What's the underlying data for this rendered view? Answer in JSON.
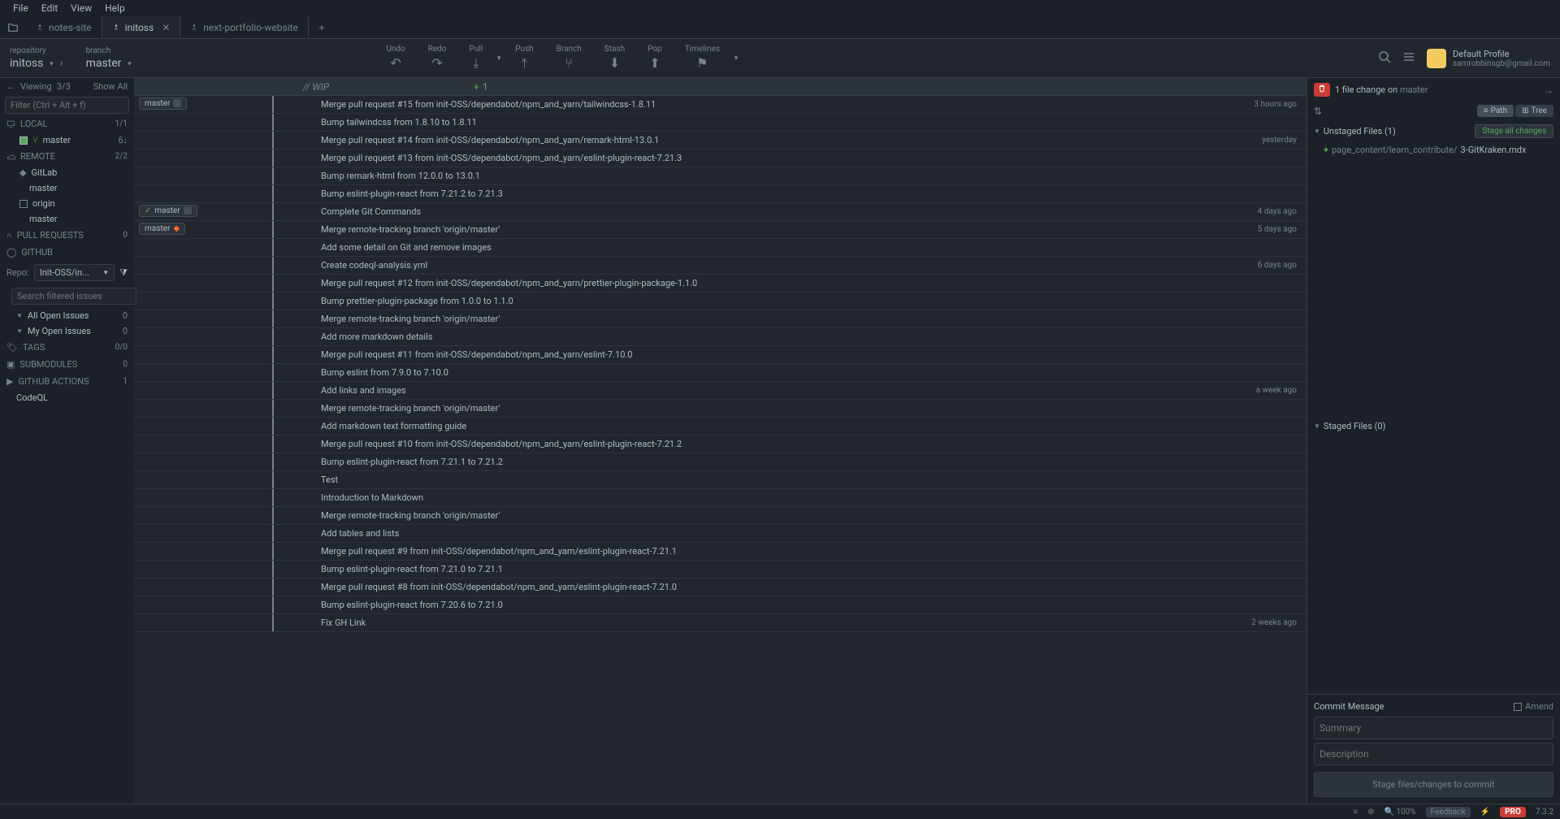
{
  "menubar": [
    "File",
    "Edit",
    "View",
    "Help"
  ],
  "tabs": [
    {
      "name": "notes-site",
      "active": false
    },
    {
      "name": "initoss",
      "active": true
    },
    {
      "name": "next-portfolio-website",
      "active": false
    }
  ],
  "toolbar": {
    "repository_label": "repository",
    "repository_value": "initoss",
    "branch_label": "branch",
    "branch_value": "master",
    "buttons": [
      "Undo",
      "Redo",
      "Pull",
      "Push",
      "Branch",
      "Stash",
      "Pop",
      "Timelines"
    ]
  },
  "profile": {
    "name": "Default Profile",
    "email": "samrobbinsgb@gmail.com"
  },
  "sidebar": {
    "viewing": "Viewing",
    "viewing_count": "3/3",
    "show_all": "Show All",
    "filter_placeholder": "Filter (Ctrl + Alt + f)",
    "local": {
      "label": "LOCAL",
      "count": "1/1",
      "items": [
        {
          "name": "master",
          "count": "6↓"
        }
      ]
    },
    "remote": {
      "label": "REMOTE",
      "count": "2/2",
      "items": [
        {
          "name": "GitLab",
          "children": [
            {
              "name": "master"
            }
          ]
        },
        {
          "name": "origin",
          "children": [
            {
              "name": "master"
            }
          ]
        }
      ]
    },
    "pull_requests": {
      "label": "PULL REQUESTS",
      "count": "0"
    },
    "github": {
      "label": "GITHUB"
    },
    "repo_label": "Repo:",
    "repo_value": "Init-OSS/in...",
    "search_placeholder": "Search filtered issues",
    "all_issues": {
      "label": "All Open Issues",
      "count": "0"
    },
    "my_issues": {
      "label": "My Open Issues",
      "count": "0"
    },
    "tags": {
      "label": "TAGS",
      "count": "0/0"
    },
    "submodules": {
      "label": "SUBMODULES",
      "count": "0"
    },
    "actions": {
      "label": "GITHUB ACTIONS",
      "count": "1",
      "items": [
        "CodeQL"
      ]
    }
  },
  "wip": {
    "label": "// WIP",
    "count": "1"
  },
  "commits": [
    {
      "msg": "Merge pull request #15 from init-OSS/dependabot/npm_and_yarn/tailwindcss-1.8.11",
      "time": "3 hours ago",
      "badge": "master",
      "badge_icon": "local"
    },
    {
      "msg": "Bump tailwindcss from 1.8.10 to 1.8.11",
      "time": ""
    },
    {
      "msg": "Merge pull request #14 from init-OSS/dependabot/npm_and_yarn/remark-html-13.0.1",
      "time": "yesterday"
    },
    {
      "msg": "Merge pull request #13 from init-OSS/dependabot/npm_and_yarn/eslint-plugin-react-7.21.3",
      "time": ""
    },
    {
      "msg": "Bump remark-html from 12.0.0 to 13.0.1",
      "time": ""
    },
    {
      "msg": "Bump eslint-plugin-react from 7.21.2 to 7.21.3",
      "time": ""
    },
    {
      "msg": "Complete Git Commands",
      "time": "4 days ago",
      "badge": "master",
      "badge_icon": "remote",
      "checked": true
    },
    {
      "msg": "Merge remote-tracking branch 'origin/master'",
      "time": "5 days ago",
      "badge": "master",
      "badge_icon": "gitlab"
    },
    {
      "msg": "Add some detail on Git and remove images",
      "time": ""
    },
    {
      "msg": "Create codeql-analysis.yml",
      "time": "6 days ago"
    },
    {
      "msg": "Merge pull request #12 from init-OSS/dependabot/npm_and_yarn/prettier-plugin-package-1.1.0",
      "time": ""
    },
    {
      "msg": "Bump prettier-plugin-package from 1.0.0 to 1.1.0",
      "time": ""
    },
    {
      "msg": "Merge remote-tracking branch 'origin/master'",
      "time": ""
    },
    {
      "msg": "Add more markdown details",
      "time": ""
    },
    {
      "msg": "Merge pull request #11 from init-OSS/dependabot/npm_and_yarn/eslint-7.10.0",
      "time": ""
    },
    {
      "msg": "Bump eslint from 7.9.0 to 7.10.0",
      "time": ""
    },
    {
      "msg": "Add links and images",
      "time": "a week ago"
    },
    {
      "msg": "Merge remote-tracking branch 'origin/master'",
      "time": ""
    },
    {
      "msg": "Add markdown text formatting guide",
      "time": ""
    },
    {
      "msg": "Merge pull request #10 from init-OSS/dependabot/npm_and_yarn/eslint-plugin-react-7.21.2",
      "time": ""
    },
    {
      "msg": "Bump eslint-plugin-react from 7.21.1 to 7.21.2",
      "time": ""
    },
    {
      "msg": "Test",
      "time": ""
    },
    {
      "msg": "Introduction to Markdown",
      "time": ""
    },
    {
      "msg": "Merge remote-tracking branch 'origin/master'",
      "time": ""
    },
    {
      "msg": "Add tables and lists",
      "time": ""
    },
    {
      "msg": "Merge pull request #9 from init-OSS/dependabot/npm_and_yarn/eslint-plugin-react-7.21.1",
      "time": ""
    },
    {
      "msg": "Bump eslint-plugin-react from 7.21.0 to 7.21.1",
      "time": ""
    },
    {
      "msg": "Merge pull request #8 from init-OSS/dependabot/npm_and_yarn/eslint-plugin-react-7.21.0",
      "time": ""
    },
    {
      "msg": "Bump eslint-plugin-react from 7.20.6 to 7.21.0",
      "time": ""
    },
    {
      "msg": "Fix GH Link",
      "time": "2 weeks ago"
    }
  ],
  "right": {
    "header": "1 file change on",
    "branch": "master",
    "path_btn": "Path",
    "tree_btn": "Tree",
    "unstaged": "Unstaged Files (1)",
    "stage_all": "Stage all changes",
    "file_path": "page_content/learn_contribute/",
    "file_name": "3-GitKraken.mdx",
    "staged": "Staged Files (0)",
    "commit_label": "Commit Message",
    "amend": "Amend",
    "summary_placeholder": "Summary",
    "description_placeholder": "Description",
    "commit_btn": "Stage files/changes to commit"
  },
  "statusbar": {
    "zoom": "100%",
    "feedback": "Feedback",
    "pro": "PRO",
    "version": "7.3.2"
  }
}
